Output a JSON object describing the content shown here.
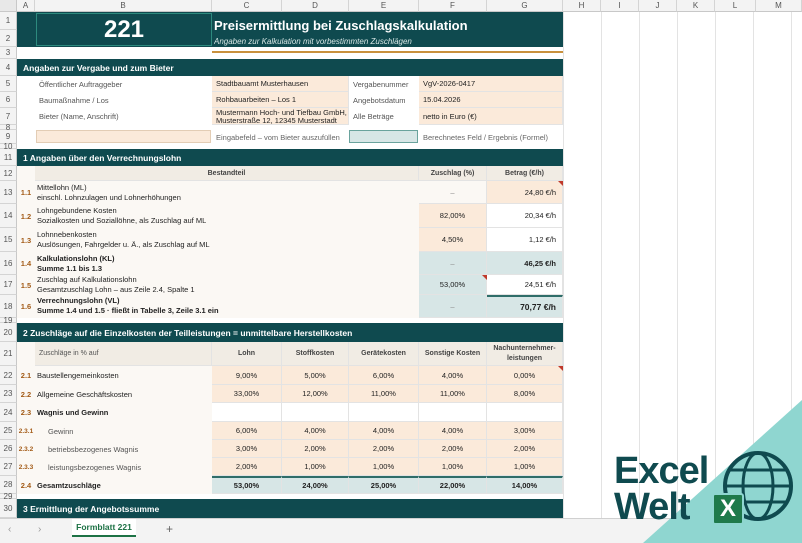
{
  "columns": [
    "A",
    "B",
    "C",
    "D",
    "E",
    "F",
    "G",
    "H",
    "I",
    "J",
    "K",
    "L",
    "M"
  ],
  "rows": [
    "1",
    "2",
    "3",
    "4",
    "5",
    "6",
    "7",
    "8",
    "9",
    "10",
    "11",
    "12",
    "13",
    "14",
    "15",
    "16",
    "17",
    "18",
    "19",
    "20",
    "21",
    "22",
    "23",
    "24",
    "25",
    "26",
    "27",
    "28",
    "29",
    "30"
  ],
  "header": {
    "form_no": "221",
    "title": "Preisermittlung bei Zuschlagskalkulation",
    "subtitle": "Angaben zur Kalkulation mit vorbestimmten Zuschlägen"
  },
  "bidder": {
    "section_title": "Angaben zur Vergabe und zum Bieter",
    "client_label": "Öffentlicher Auftraggeber",
    "client_value": "Stadtbauamt Musterhausen",
    "vergabe_label": "Vergabenummer",
    "vergabe_value": "VgV-2026-0417",
    "project_label": "Baumaßnahme / Los",
    "project_value": "Rohbauarbeiten – Los 1",
    "date_label": "Angebotsdatum",
    "date_value": "15.04.2026",
    "bidder_label": "Bieter (Name, Anschrift)",
    "bidder_value1": "Mustermann Hoch- und Tiefbau GmbH,",
    "bidder_value2": "Musterstraße 12, 12345 Musterstadt",
    "amount_label": "Alle Beträge",
    "amount_value": "netto in Euro (€)",
    "legend_input": "Eingabefeld – vom Bieter auszufüllen",
    "legend_calc": "Berechnetes Feld / Ergebnis (Formel)"
  },
  "s1": {
    "title": "1  Angaben über den Verrechnungslohn",
    "col_bestandteil": "Bestandteil",
    "col_zuschlag": "Zuschlag (%)",
    "col_betrag": "Betrag (€/h)",
    "rows": [
      {
        "num": "1.1",
        "l1": "Mittellohn (ML)",
        "l2": "einschl. Lohnzulagen und Lohnerhöhungen",
        "z": "–",
        "b": "24,80 €/h"
      },
      {
        "num": "1.2",
        "l1": "Lohngebundene Kosten",
        "l2": "Sozialkosten und Soziallöhne, als Zuschlag auf ML",
        "z": "82,00%",
        "b": "20,34 €/h"
      },
      {
        "num": "1.3",
        "l1": "Lohnnebenkosten",
        "l2": "Auslösungen, Fahrgelder u. Ä., als Zuschlag auf ML",
        "z": "4,50%",
        "b": "1,12 €/h"
      },
      {
        "num": "1.4",
        "l1": "Kalkulationslohn (KL)",
        "l2": "Summe 1.1 bis 1.3",
        "z": "–",
        "b": "46,25 €/h"
      },
      {
        "num": "1.5",
        "l1": "Zuschlag auf Kalkulationslohn",
        "l2": "Gesamtzuschlag Lohn – aus Zeile 2.4, Spalte 1",
        "z": "53,00%",
        "b": "24,51 €/h"
      },
      {
        "num": "1.6",
        "l1": "Verrechnungslohn (VL)",
        "l2": "Summe 1.4 und 1.5 · fließt in Tabelle 3, Zeile 3.1 ein",
        "z": "–",
        "b": "70,77 €/h"
      }
    ]
  },
  "s2": {
    "title": "2  Zuschläge auf die Einzelkosten der Teilleistungen  = unmittelbare Herstellkosten",
    "col_label": "Zuschläge in % auf",
    "cols": [
      "Lohn",
      "Stoffkosten",
      "Gerätekosten",
      "Sonstige Kosten",
      "Nachunternehmer-",
      "leistungen"
    ],
    "rows": [
      {
        "num": "2.1",
        "label": "Baustellengemeinkosten",
        "v": [
          "9,00%",
          "5,00%",
          "6,00%",
          "4,00%",
          "0,00%"
        ]
      },
      {
        "num": "2.2",
        "label": "Allgemeine Geschäftskosten",
        "v": [
          "33,00%",
          "12,00%",
          "11,00%",
          "11,00%",
          "8,00%"
        ]
      },
      {
        "num": "2.3",
        "label": "Wagnis und Gewinn",
        "v": [
          "",
          "",
          "",
          "",
          ""
        ]
      },
      {
        "num": "2.3.1",
        "label": "Gewinn",
        "v": [
          "6,00%",
          "4,00%",
          "4,00%",
          "4,00%",
          "3,00%"
        ]
      },
      {
        "num": "2.3.2",
        "label": "betriebsbezogenes Wagnis",
        "v": [
          "3,00%",
          "2,00%",
          "2,00%",
          "2,00%",
          "2,00%"
        ]
      },
      {
        "num": "2.3.3",
        "label": "leistungsbezogenes Wagnis",
        "v": [
          "2,00%",
          "1,00%",
          "1,00%",
          "1,00%",
          "1,00%"
        ]
      },
      {
        "num": "2.4",
        "label": "Gesamtzuschläge",
        "v": [
          "53,00%",
          "24,00%",
          "25,00%",
          "22,00%",
          "14,00%"
        ]
      }
    ]
  },
  "s3": {
    "title": "3  Ermittlung der Angebotssumme"
  },
  "sheet_tab": "Formblatt 221",
  "add_sheet": "+",
  "logo": {
    "line1": "Excel",
    "line2": "Welt",
    "badge": "X"
  }
}
